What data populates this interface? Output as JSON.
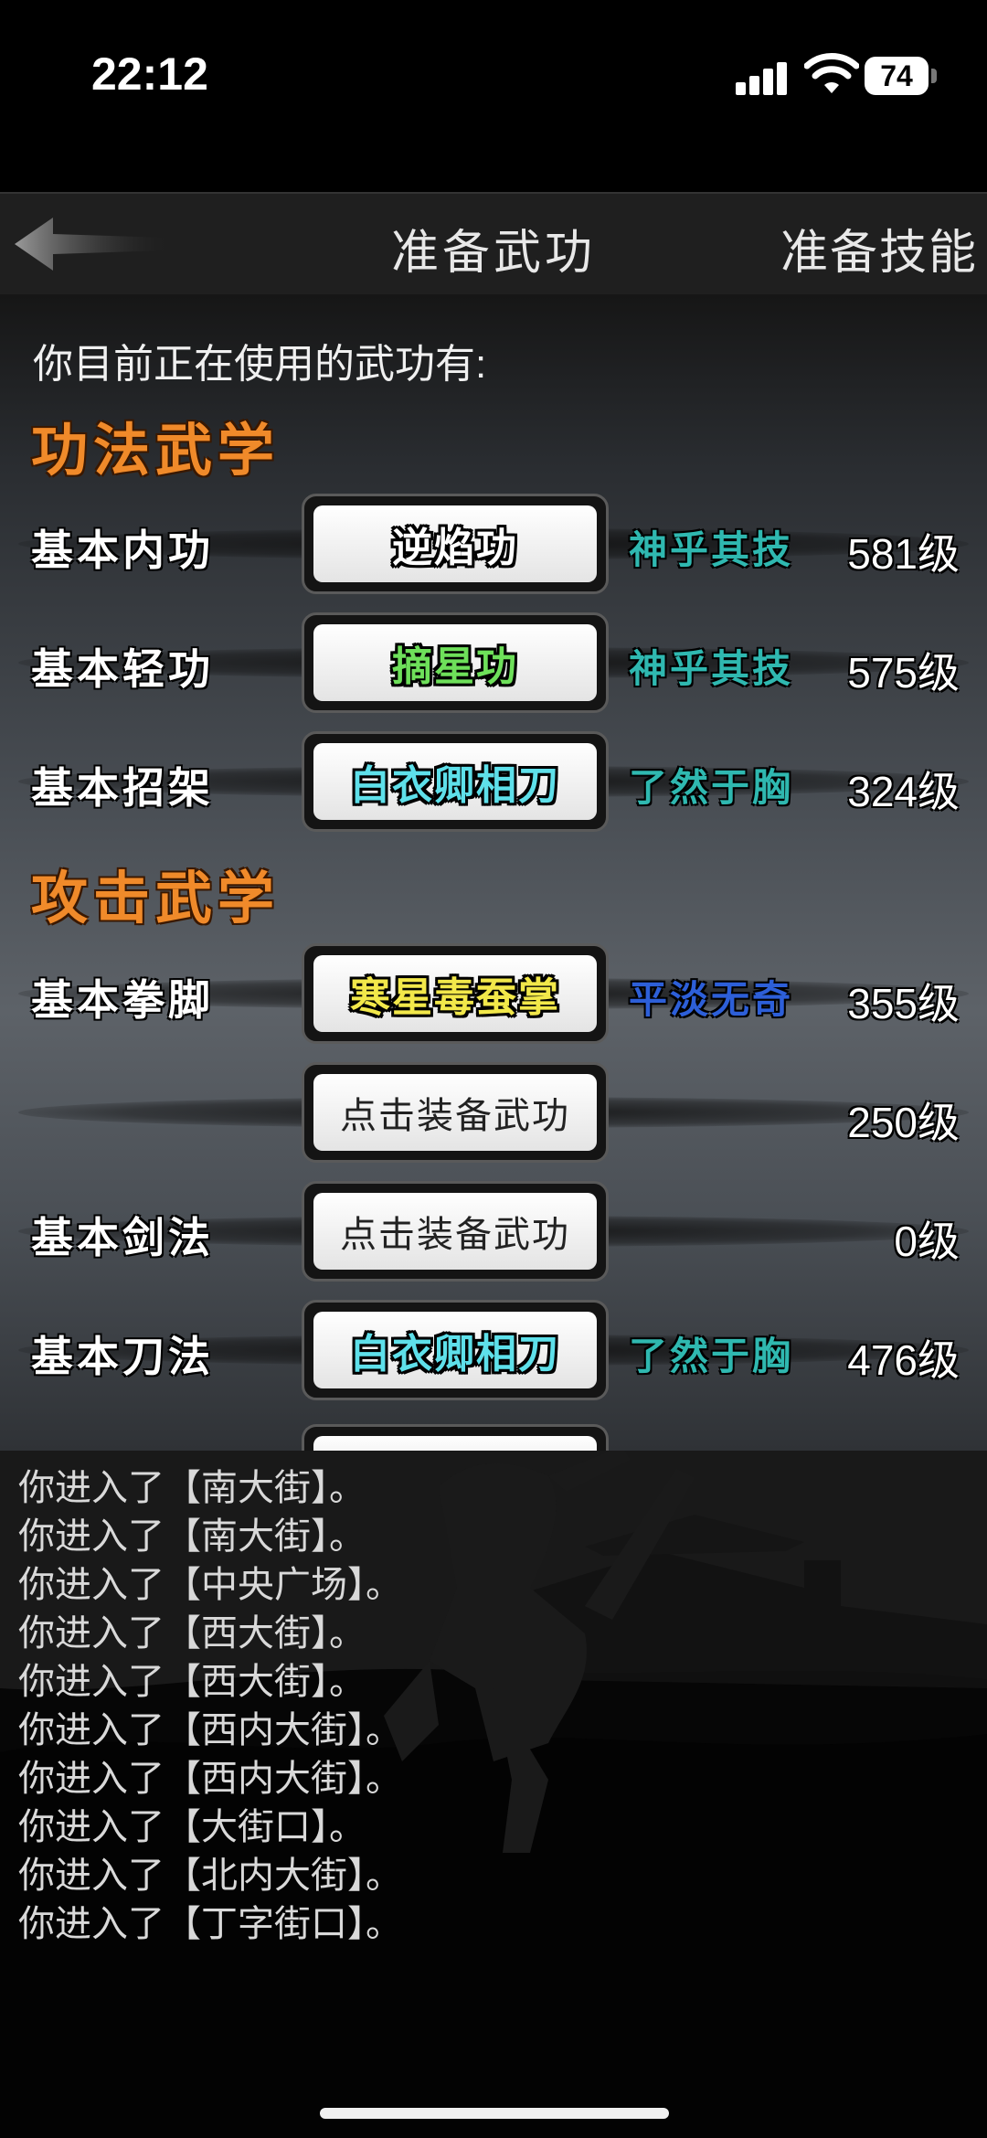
{
  "status_bar": {
    "time": "22:12",
    "battery": "74"
  },
  "header": {
    "title": "准备武功",
    "right_button": "准备技能"
  },
  "intro": "你目前正在使用的武功有:",
  "sections": [
    {
      "title": "功法武学"
    },
    {
      "title": "攻击武学"
    }
  ],
  "slots": [
    {
      "label": "基本内功",
      "skill": "逆焰功",
      "skill_color": "white",
      "rank": "神乎其技",
      "rank_color": "teal",
      "level": "581级"
    },
    {
      "label": "基本轻功",
      "skill": "摘星功",
      "skill_color": "green",
      "rank": "神乎其技",
      "rank_color": "teal",
      "level": "575级"
    },
    {
      "label": "基本招架",
      "skill": "白衣卿相刀",
      "skill_color": "cyan",
      "rank": "了然于胸",
      "rank_color": "teal",
      "level": "324级"
    },
    {
      "label": "基本拳脚",
      "skill": "寒星毒蚕掌",
      "skill_color": "yellow",
      "rank": "平淡无奇",
      "rank_color": "blue",
      "level": "355级"
    },
    {
      "label": "",
      "skill": "点击装备武功",
      "skill_color": "equip",
      "rank": "",
      "rank_color": "",
      "level": "250级"
    },
    {
      "label": "基本剑法",
      "skill": "点击装备武功",
      "skill_color": "equip",
      "rank": "",
      "rank_color": "",
      "level": "0级"
    },
    {
      "label": "基本刀法",
      "skill": "白衣卿相刀",
      "skill_color": "cyan",
      "rank": "了然于胸",
      "rank_color": "teal",
      "level": "476级"
    }
  ],
  "log": [
    "你进入了【南大街】。",
    "你进入了【南大街】。",
    "你进入了【中央广场】。",
    "你进入了【西大街】。",
    "你进入了【西大街】。",
    "你进入了【西内大街】。",
    "你进入了【西内大街】。",
    "你进入了【大街口】。",
    "你进入了【北内大街】。",
    "你进入了【丁字街口】。"
  ],
  "colors": {
    "section_orange": "#f08a2a",
    "rank_teal": "#2fb8b0",
    "rank_blue": "#2d5fd8",
    "skill_green": "#6ee05a",
    "skill_cyan": "#5ee0ea",
    "skill_yellow": "#f2e84a"
  }
}
